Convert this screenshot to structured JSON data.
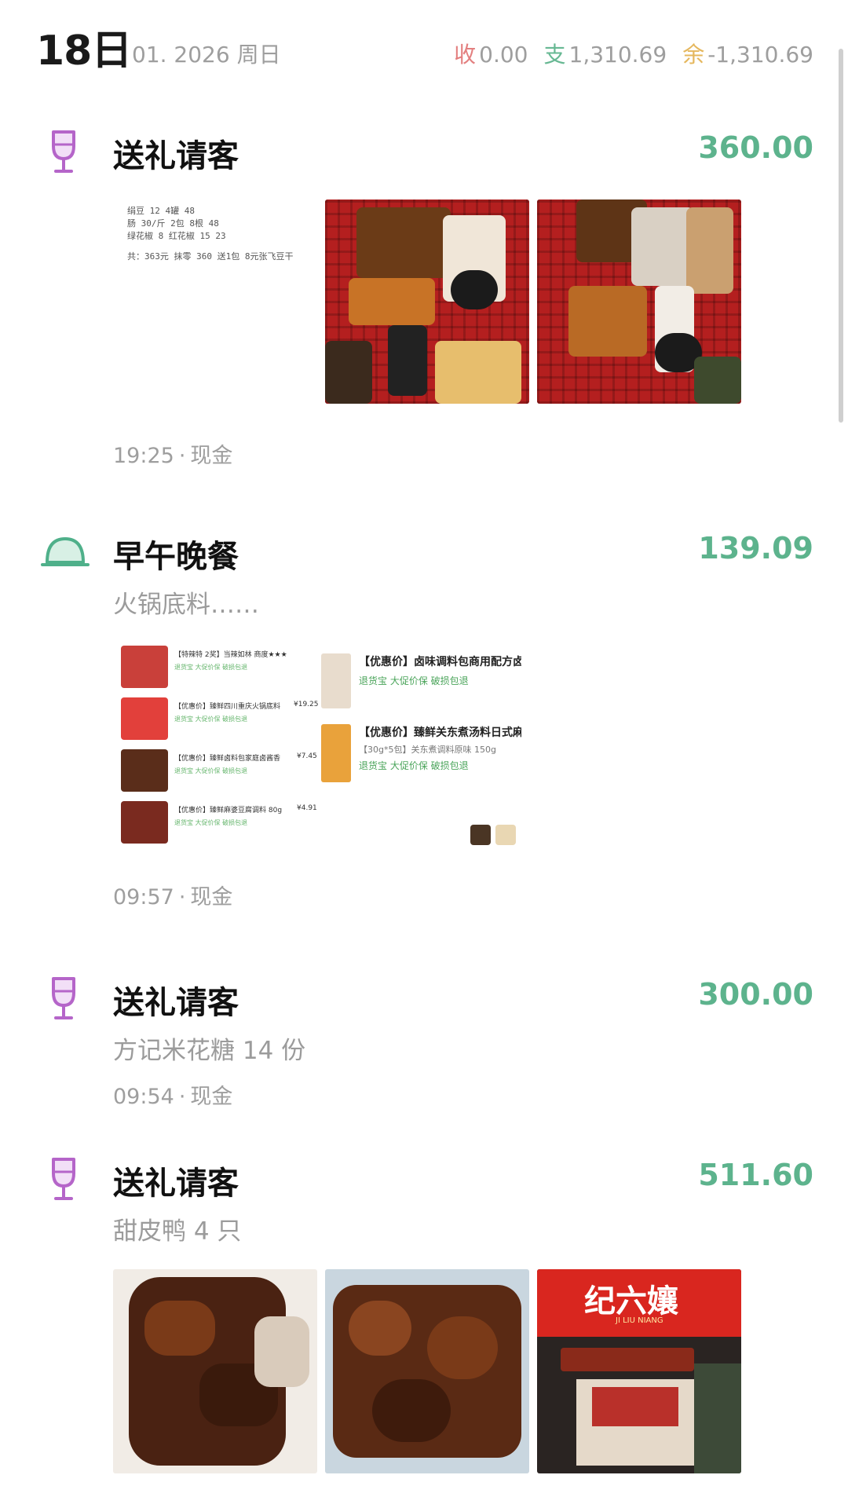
{
  "header": {
    "day": "18日",
    "date": "01. 2026  周日",
    "income_label": "收",
    "income_value": "0.00",
    "expense_label": "支",
    "expense_value": "1,310.69",
    "balance_label": "余",
    "balance_value": "-1,310.69"
  },
  "colors": {
    "amount": "#5db38d",
    "income": "#e37f7f",
    "expense": "#67b893",
    "balance": "#e5b75d",
    "gift_icon": "#b565c9",
    "meal_icon": "#4fb08a"
  },
  "entries": [
    {
      "icon": "wine-glass-icon",
      "category": "送礼请客",
      "amount": "360.00",
      "note": "",
      "time": "19:25",
      "account": "现金",
      "receipt_lines": [
        "绢豆 12 4罐 48",
        "肠 30/斤 2包 8根 48",
        "绿花椒 8 红花椒 15 23",
        "共：363元 抹零 360 送1包 8元张飞豆干"
      ]
    },
    {
      "icon": "meal-cover-icon",
      "category": "早午晚餐",
      "amount": "139.09",
      "note": "火锅底料……",
      "time": "09:57",
      "account": "现金",
      "order_left": [
        {
          "title": "【特辣特 2奖】当辣如林 商度★★★",
          "tags": "退货宝  大促价保  破损包退",
          "price": ""
        },
        {
          "title": "【优惠价】臻鲜四川重庆火锅底料",
          "tags": "退货宝  大促价保  破损包退",
          "price": "¥19.25"
        },
        {
          "title": "【优惠价】臻鲜卤料包家庭卤酱香",
          "tags": "退货宝  大促价保  破损包退",
          "price": "¥7.45"
        },
        {
          "title": "【优惠价】臻鲜麻婆豆腐调料 80g",
          "tags": "退货宝  大促价保  破损包退",
          "price": "¥4.91"
        }
      ],
      "order_right": [
        {
          "title": "【优惠价】卤味调料包商用配方卤",
          "spec": "",
          "tags": "退货宝   大促价保   破损包退"
        },
        {
          "title": "【优惠价】臻鲜关东煮汤料日式麻",
          "spec": "【30g*5包】关东煮调料原味 150g",
          "tags": "退货宝   大促价保   破损包退"
        }
      ]
    },
    {
      "icon": "wine-glass-icon",
      "category": "送礼请客",
      "amount": "300.00",
      "note": "方记米花糖 14 份",
      "time": "09:54",
      "account": "现金"
    },
    {
      "icon": "wine-glass-icon",
      "category": "送礼请客",
      "amount": "511.60",
      "note": "甜皮鸭 4 只",
      "shop_sign": "纪六孃",
      "shop_sign_en": "JI LIU NIANG"
    }
  ]
}
